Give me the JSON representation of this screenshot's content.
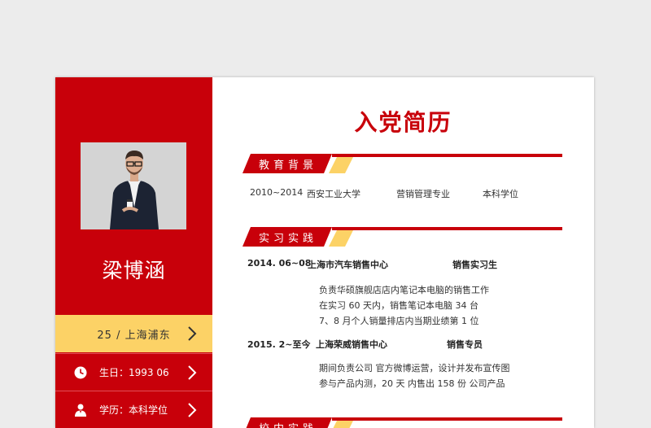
{
  "resume": {
    "title": "入党简历",
    "name": "梁博涵",
    "info": {
      "location": "25 /  上海浦东",
      "birth": "生日：1993 06",
      "education": "学历：本科学位"
    },
    "sections": {
      "education": {
        "title": "教育背景",
        "period": "2010~2014",
        "school": "西安工业大学",
        "major": "营销管理专业",
        "degree": "本科学位"
      },
      "internship": {
        "title": "实习实践",
        "jobs": [
          {
            "period": "2014. 06~08",
            "company": "上海市汽车销售中心",
            "role": "销售实习生",
            "details": [
              "负责华硕旗舰店店内笔记本电脑的销售工作",
              "在实习 60 天内，销售笔记本电脑 34 台",
              "7、8 月个人销量排店内当期业绩第 1 位"
            ]
          },
          {
            "period": "2015. 2~至今",
            "company": "上海荣威销售中心",
            "role": "销售专员",
            "details": [
              "期间负责公司  官方微博运营，设计并发布宣传图",
              "参与产品内测，20 天  内售出  158 份  公司产品"
            ]
          }
        ]
      },
      "campus": {
        "title": "校内实践"
      }
    }
  },
  "icons": {
    "clock": "clock-icon",
    "person": "person-icon",
    "chevron": "chevron-right-icon"
  },
  "colors": {
    "primary_red": "#c8000a",
    "accent_yellow": "#fcd266",
    "background": "#ececec"
  }
}
